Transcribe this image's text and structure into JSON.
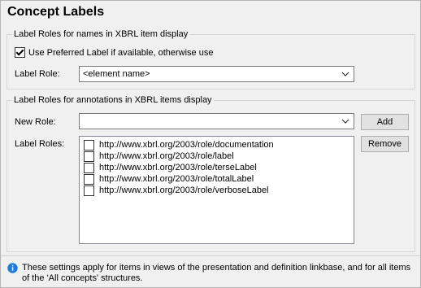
{
  "dialog": {
    "title": "Concept Labels",
    "group1": {
      "legend": "Label Roles for names in XBRL item display",
      "checkbox_label": "Use Preferred Label if available, otherwise use",
      "checkbox_checked": true,
      "label_role_caption": "Label Role:",
      "label_role_value": "<element name>"
    },
    "group2": {
      "legend": "Label Roles for annotations in XBRL items display",
      "new_role_caption": "New Role:",
      "new_role_value": "",
      "label_roles_caption": "Label Roles:",
      "roles": [
        {
          "label": "http://www.xbrl.org/2003/role/documentation",
          "checked": false
        },
        {
          "label": "http://www.xbrl.org/2003/role/label",
          "checked": false
        },
        {
          "label": "http://www.xbrl.org/2003/role/terseLabel",
          "checked": false
        },
        {
          "label": "http://www.xbrl.org/2003/role/totalLabel",
          "checked": false
        },
        {
          "label": "http://www.xbrl.org/2003/role/verboseLabel",
          "checked": false
        }
      ],
      "add_button": "Add",
      "remove_button": "Remove"
    },
    "note": {
      "icon": "info-icon",
      "text": "These settings apply for items in views of the presentation and definition linkbase, and for all items of the 'All concepts' structures."
    }
  }
}
